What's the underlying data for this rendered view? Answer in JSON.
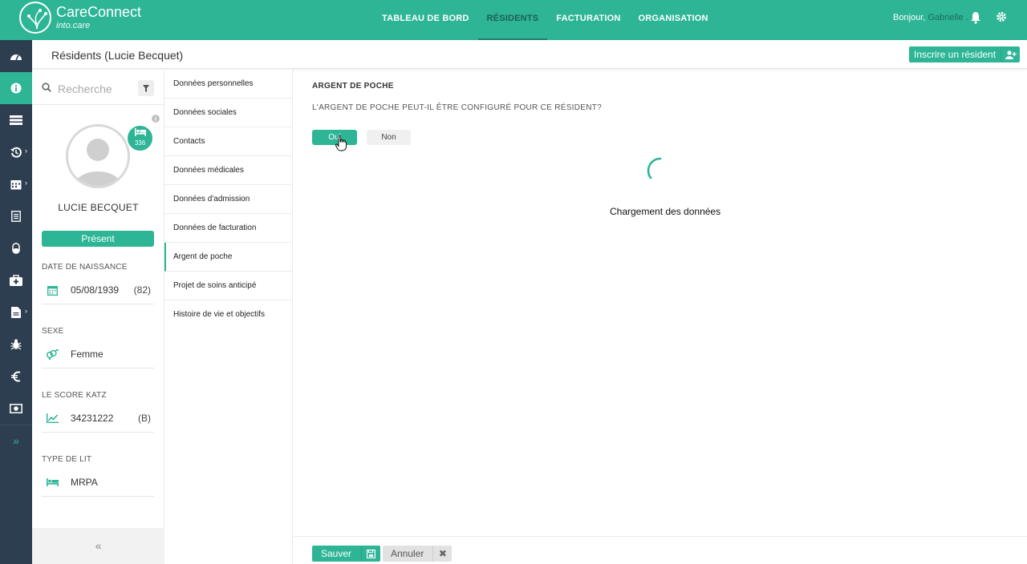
{
  "app": {
    "name": "CareConnect",
    "subtitle": "into.care",
    "accent_color": "#2db596",
    "rail_color": "#2c3e50"
  },
  "topnav": {
    "items": [
      {
        "label": "TABLEAU DE BORD",
        "active": false
      },
      {
        "label": "RÉSIDENTS",
        "active": true
      },
      {
        "label": "FACTURATION",
        "active": false
      },
      {
        "label": "ORGANISATION",
        "active": false
      }
    ],
    "greeting": "Bonjour,",
    "user_name": "Gabrielle ."
  },
  "rail": {
    "items": [
      {
        "icon": "dashboard-icon"
      },
      {
        "icon": "info-icon",
        "active": true
      },
      {
        "icon": "list-icon"
      },
      {
        "icon": "history-icon",
        "has_submenu": true
      },
      {
        "icon": "calendar-icon",
        "has_submenu": true
      },
      {
        "icon": "notes-icon"
      },
      {
        "icon": "pill-icon"
      },
      {
        "icon": "medkit-icon"
      },
      {
        "icon": "document-icon",
        "has_submenu": true
      },
      {
        "icon": "bug-icon"
      },
      {
        "icon": "euro-icon"
      },
      {
        "icon": "money-icon"
      }
    ],
    "expand": "»",
    "chevron": "›"
  },
  "subheader": {
    "title": "Résidents (Lucie Becquet)",
    "enroll_label": "Inscrire un résident"
  },
  "profile": {
    "search_placeholder": "Recherche",
    "room_number": "336",
    "name": "LUCIE BECQUET",
    "status": "Présent",
    "birth_label": "DATE DE NAISSANCE",
    "birth_date": "05/08/1939",
    "age": "(82)",
    "sex_label": "SEXE",
    "sex": "Femme",
    "katz_label": "LE SCORE KATZ",
    "katz_score": "34231222",
    "katz_class": "(B)",
    "bed_label": "TYPE DE LIT",
    "bed_type": "MRPA",
    "collapse": "«"
  },
  "sections": {
    "items": [
      {
        "label": "Données personnelles"
      },
      {
        "label": "Données sociales"
      },
      {
        "label": "Contacts"
      },
      {
        "label": "Données médicales"
      },
      {
        "label": "Données d'admission"
      },
      {
        "label": "Données de facturation"
      },
      {
        "label": "Argent de poche",
        "active": true
      },
      {
        "label": "Projet de soins anticipé"
      },
      {
        "label": "Histoire de vie et objectifs"
      }
    ]
  },
  "main": {
    "title": "ARGENT DE POCHE",
    "question": "L'ARGENT DE POCHE PEUT-IL ÊTRE CONFIGURÉ POUR CE RÉSIDENT?",
    "yes_label": "Oui",
    "no_label": "Non",
    "loading_text": "Chargement des données"
  },
  "footer": {
    "save_label": "Sauver",
    "cancel_label": "Annuler",
    "cancel_icon": "✖"
  }
}
